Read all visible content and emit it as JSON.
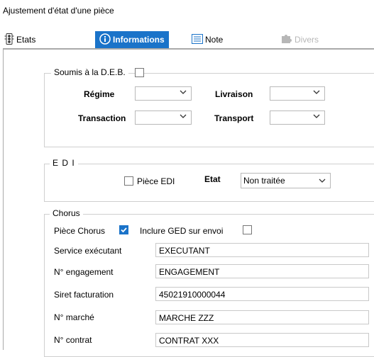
{
  "window": {
    "title": "Ajustement d'état d'une pièce"
  },
  "tabs": [
    {
      "label": "Etats",
      "icon": "traffic-light-icon"
    },
    {
      "label": "Informations",
      "icon": "info-icon",
      "active": true
    },
    {
      "label": "Note",
      "icon": "note-icon"
    },
    {
      "label": "Divers",
      "icon": "puzzle-icon",
      "disabled": true
    }
  ],
  "deb": {
    "legend": "Soumis à la D.E.B.",
    "checked": false,
    "regime_label": "Régime",
    "livraison_label": "Livraison",
    "transaction_label": "Transaction",
    "transport_label": "Transport"
  },
  "edi": {
    "legend": "E D I",
    "piece_edi_label": "Pièce EDI",
    "piece_edi_checked": false,
    "etat_label": "Etat",
    "etat_value": "Non traitée"
  },
  "chorus": {
    "legend": "Chorus",
    "piece_chorus_label": "Pièce Chorus",
    "piece_chorus_checked": true,
    "inclure_ged_label": "Inclure GED sur envoi",
    "inclure_ged_checked": false,
    "service_label": "Service exécutant",
    "service_value": "EXECUTANT",
    "engagement_label": "N° engagement",
    "engagement_value": "ENGAGEMENT",
    "siret_label": "Siret facturation",
    "siret_value": "45021910000044",
    "marche_label": "N° marché",
    "marche_value": "MARCHE ZZZ",
    "contrat_label": "N° contrat",
    "contrat_value": "CONTRAT XXX"
  },
  "colors": {
    "accent": "#1a73c9",
    "disabled": "#b7b7b7",
    "border": "#cfcfcf"
  }
}
